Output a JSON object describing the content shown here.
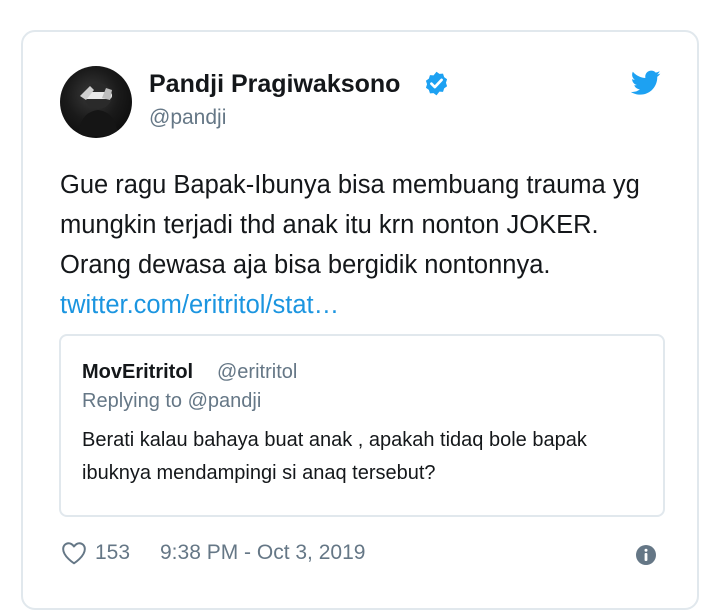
{
  "tweet": {
    "display_name": "Pandji Pragiwaksono",
    "handle": "@pandji",
    "text": "Gue ragu Bapak-Ibunya bisa membuang trauma yg mungkin terjadi thd anak itu krn nonton JOKER. Orang dewasa aja bisa bergidik nontonnya. ",
    "link": "twitter.com/eritritol/stat…",
    "likes": "153",
    "timestamp": "9:38 PM - Oct 3, 2019"
  },
  "quoted": {
    "name": "MovEritritol",
    "handle": "@eritritol",
    "replying_to": "Replying to @pandji",
    "text": "Berati kalau bahaya buat anak , apakah tidaq bole bapak ibuknya mendampingi si anaq tersebut?"
  },
  "icons": {
    "verified": "verified-badge-icon",
    "bird": "twitter-bird-icon",
    "heart": "heart-icon",
    "info": "info-icon"
  },
  "colors": {
    "accent": "#1da1f2",
    "link": "#1b95e0",
    "secondary_text": "#657786",
    "border": "#e1e8ed"
  }
}
